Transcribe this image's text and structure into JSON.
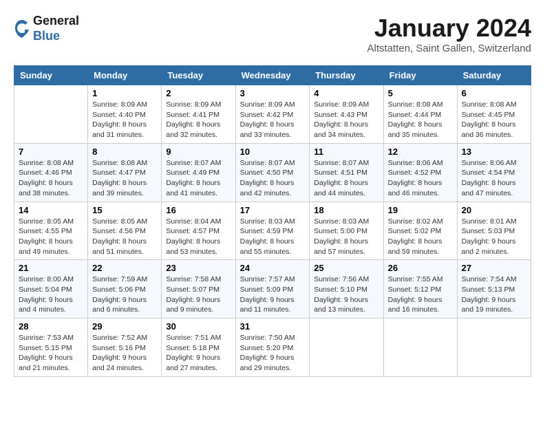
{
  "header": {
    "logo": {
      "line1": "General",
      "line2": "Blue"
    },
    "title": "January 2024",
    "location": "Altstatten, Saint Gallen, Switzerland"
  },
  "calendar": {
    "weekdays": [
      "Sunday",
      "Monday",
      "Tuesday",
      "Wednesday",
      "Thursday",
      "Friday",
      "Saturday"
    ],
    "weeks": [
      [
        {
          "day": "",
          "info": ""
        },
        {
          "day": "1",
          "info": "Sunrise: 8:09 AM\nSunset: 4:40 PM\nDaylight: 8 hours\nand 31 minutes."
        },
        {
          "day": "2",
          "info": "Sunrise: 8:09 AM\nSunset: 4:41 PM\nDaylight: 8 hours\nand 32 minutes."
        },
        {
          "day": "3",
          "info": "Sunrise: 8:09 AM\nSunset: 4:42 PM\nDaylight: 8 hours\nand 33 minutes."
        },
        {
          "day": "4",
          "info": "Sunrise: 8:09 AM\nSunset: 4:43 PM\nDaylight: 8 hours\nand 34 minutes."
        },
        {
          "day": "5",
          "info": "Sunrise: 8:08 AM\nSunset: 4:44 PM\nDaylight: 8 hours\nand 35 minutes."
        },
        {
          "day": "6",
          "info": "Sunrise: 8:08 AM\nSunset: 4:45 PM\nDaylight: 8 hours\nand 36 minutes."
        }
      ],
      [
        {
          "day": "7",
          "info": "Sunrise: 8:08 AM\nSunset: 4:46 PM\nDaylight: 8 hours\nand 38 minutes."
        },
        {
          "day": "8",
          "info": "Sunrise: 8:08 AM\nSunset: 4:47 PM\nDaylight: 8 hours\nand 39 minutes."
        },
        {
          "day": "9",
          "info": "Sunrise: 8:07 AM\nSunset: 4:49 PM\nDaylight: 8 hours\nand 41 minutes."
        },
        {
          "day": "10",
          "info": "Sunrise: 8:07 AM\nSunset: 4:50 PM\nDaylight: 8 hours\nand 42 minutes."
        },
        {
          "day": "11",
          "info": "Sunrise: 8:07 AM\nSunset: 4:51 PM\nDaylight: 8 hours\nand 44 minutes."
        },
        {
          "day": "12",
          "info": "Sunrise: 8:06 AM\nSunset: 4:52 PM\nDaylight: 8 hours\nand 46 minutes."
        },
        {
          "day": "13",
          "info": "Sunrise: 8:06 AM\nSunset: 4:54 PM\nDaylight: 8 hours\nand 47 minutes."
        }
      ],
      [
        {
          "day": "14",
          "info": "Sunrise: 8:05 AM\nSunset: 4:55 PM\nDaylight: 8 hours\nand 49 minutes."
        },
        {
          "day": "15",
          "info": "Sunrise: 8:05 AM\nSunset: 4:56 PM\nDaylight: 8 hours\nand 51 minutes."
        },
        {
          "day": "16",
          "info": "Sunrise: 8:04 AM\nSunset: 4:57 PM\nDaylight: 8 hours\nand 53 minutes."
        },
        {
          "day": "17",
          "info": "Sunrise: 8:03 AM\nSunset: 4:59 PM\nDaylight: 8 hours\nand 55 minutes."
        },
        {
          "day": "18",
          "info": "Sunrise: 8:03 AM\nSunset: 5:00 PM\nDaylight: 8 hours\nand 57 minutes."
        },
        {
          "day": "19",
          "info": "Sunrise: 8:02 AM\nSunset: 5:02 PM\nDaylight: 8 hours\nand 59 minutes."
        },
        {
          "day": "20",
          "info": "Sunrise: 8:01 AM\nSunset: 5:03 PM\nDaylight: 9 hours\nand 2 minutes."
        }
      ],
      [
        {
          "day": "21",
          "info": "Sunrise: 8:00 AM\nSunset: 5:04 PM\nDaylight: 9 hours\nand 4 minutes."
        },
        {
          "day": "22",
          "info": "Sunrise: 7:59 AM\nSunset: 5:06 PM\nDaylight: 9 hours\nand 6 minutes."
        },
        {
          "day": "23",
          "info": "Sunrise: 7:58 AM\nSunset: 5:07 PM\nDaylight: 9 hours\nand 9 minutes."
        },
        {
          "day": "24",
          "info": "Sunrise: 7:57 AM\nSunset: 5:09 PM\nDaylight: 9 hours\nand 11 minutes."
        },
        {
          "day": "25",
          "info": "Sunrise: 7:56 AM\nSunset: 5:10 PM\nDaylight: 9 hours\nand 13 minutes."
        },
        {
          "day": "26",
          "info": "Sunrise: 7:55 AM\nSunset: 5:12 PM\nDaylight: 9 hours\nand 16 minutes."
        },
        {
          "day": "27",
          "info": "Sunrise: 7:54 AM\nSunset: 5:13 PM\nDaylight: 9 hours\nand 19 minutes."
        }
      ],
      [
        {
          "day": "28",
          "info": "Sunrise: 7:53 AM\nSunset: 5:15 PM\nDaylight: 9 hours\nand 21 minutes."
        },
        {
          "day": "29",
          "info": "Sunrise: 7:52 AM\nSunset: 5:16 PM\nDaylight: 9 hours\nand 24 minutes."
        },
        {
          "day": "30",
          "info": "Sunrise: 7:51 AM\nSunset: 5:18 PM\nDaylight: 9 hours\nand 27 minutes."
        },
        {
          "day": "31",
          "info": "Sunrise: 7:50 AM\nSunset: 5:20 PM\nDaylight: 9 hours\nand 29 minutes."
        },
        {
          "day": "",
          "info": ""
        },
        {
          "day": "",
          "info": ""
        },
        {
          "day": "",
          "info": ""
        }
      ]
    ]
  }
}
